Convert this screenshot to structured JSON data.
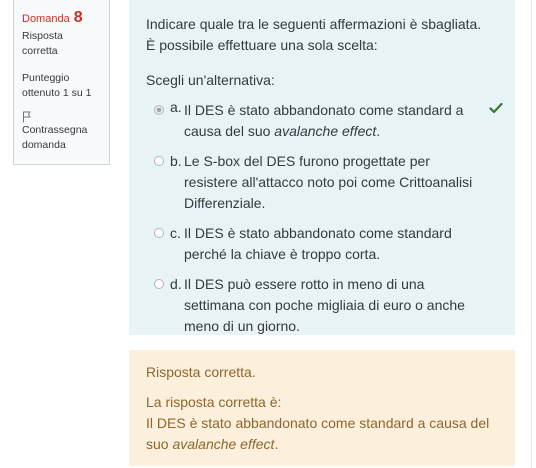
{
  "question_info": {
    "label": "Domanda",
    "number": "8",
    "state": "Risposta corretta",
    "grade": "Punteggio ottenuto 1 su 1",
    "flag_label": "Contrassegna domanda"
  },
  "question": {
    "text": "Indicare quale tra le seguenti affermazioni è sbagliata. È possibile effettuare una sola scelta:",
    "prompt": "Scegli un'alternativa:",
    "options": [
      {
        "letter": "a.",
        "text_before": "Il DES è stato abbandonato come standard a causa del suo ",
        "text_em": "avalanche effect",
        "text_after": ".",
        "selected": true,
        "correct": true
      },
      {
        "letter": "b.",
        "text": "Le S-box del DES furono progettate per resistere all'attacco noto poi come Crittoanalisi Differenziale.",
        "selected": false
      },
      {
        "letter": "c.",
        "text": "Il DES è stato abbandonato come standard perché la chiave è troppo corta.",
        "selected": false
      },
      {
        "letter": "d.",
        "text": "Il DES può essere rotto in meno di una settimana con poche migliaia di euro o anche meno di un giorno.",
        "selected": false
      }
    ]
  },
  "feedback": {
    "main": "Risposta corretta.",
    "right_answer_label": "La risposta corretta è:",
    "right_answer_before": "Il DES è stato abbandonato come standard a causa del suo ",
    "right_answer_em": "avalanche effect",
    "right_answer_after": "."
  },
  "icons": {
    "flag": "flag-icon",
    "correct": "check-icon"
  },
  "colors": {
    "accent_red": "#ca3120",
    "question_bg": "#e7f3f5",
    "feedback_bg": "#fcefdc",
    "feedback_text": "#8e662e",
    "correct_green": "#357a32"
  }
}
